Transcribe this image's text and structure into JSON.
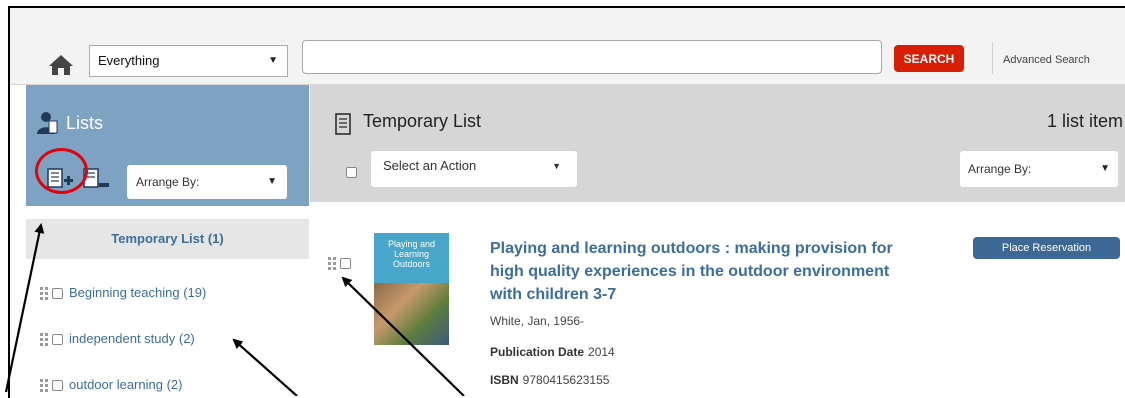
{
  "search": {
    "scope_value": "Everything",
    "query_value": "",
    "search_label": "SEARCH",
    "advanced_label": "Advanced Search"
  },
  "sidebar": {
    "title": "Lists",
    "arrange_label": "Arrange By:",
    "active_list": "Temporary List (1)",
    "lists": [
      {
        "label": "Beginning teaching (19)"
      },
      {
        "label": "independent study (2)"
      },
      {
        "label": "outdoor learning (2)"
      }
    ]
  },
  "main": {
    "title": "Temporary List",
    "count_label": "1 list item",
    "action_label": "Select an Action",
    "arrange_label": "Arrange By:",
    "result": {
      "cover_text": "Playing and Learning Outdoors",
      "title": "Playing and learning outdoors : making provision for high quality experiences in the outdoor environment with children 3-7",
      "author": "White, Jan, 1956-",
      "pubdate_label": "Publication Date",
      "pubdate_value": "2014",
      "isbn_label": "ISBN",
      "isbn_value": "9780415623155",
      "reserve_label": "Place Reservation"
    }
  },
  "colors": {
    "sidebar_header": "#7ea3c2",
    "main_header": "#d6d6d6",
    "search_button": "#d81e05",
    "link": "#3d6d9b",
    "reserve_button": "#3d6795",
    "highlight": "#e3000f"
  },
  "icons": [
    "home-icon",
    "lists-icon",
    "add-list-icon",
    "remove-list-icon",
    "list-icon",
    "drag-handle-icon",
    "chevron-down-icon"
  ]
}
